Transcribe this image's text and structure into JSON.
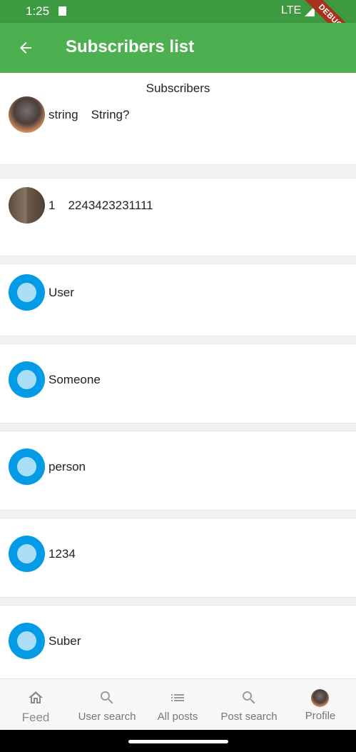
{
  "status_bar": {
    "time": "1:25",
    "network": "LTE",
    "debug_banner": "DEBUG"
  },
  "app_bar": {
    "title": "Subscribers list",
    "back_icon": "arrow-left-icon"
  },
  "list": {
    "header": "Subscribers",
    "items": [
      {
        "avatar": "photo",
        "name": "string",
        "detail": "String?"
      },
      {
        "avatar": "photo",
        "name": "1",
        "detail": "2243423231111"
      },
      {
        "avatar": "default",
        "name": "User",
        "detail": ""
      },
      {
        "avatar": "default",
        "name": "Someone",
        "detail": ""
      },
      {
        "avatar": "default",
        "name": "person",
        "detail": ""
      },
      {
        "avatar": "default",
        "name": "1234",
        "detail": ""
      },
      {
        "avatar": "default",
        "name": "Suber",
        "detail": ""
      }
    ]
  },
  "bottom_nav": {
    "items": [
      {
        "label": "Feed",
        "icon": "home-icon",
        "active": true
      },
      {
        "label": "User search",
        "icon": "search-icon"
      },
      {
        "label": "All posts",
        "icon": "list-icon"
      },
      {
        "label": "Post search",
        "icon": "search-icon"
      },
      {
        "label": "Profile",
        "icon": "avatar"
      }
    ]
  },
  "colors": {
    "primary": "#4caf50",
    "status_bar": "#3d9a41",
    "avatar_default": "#039be5",
    "debug_banner": "#a8321c"
  }
}
